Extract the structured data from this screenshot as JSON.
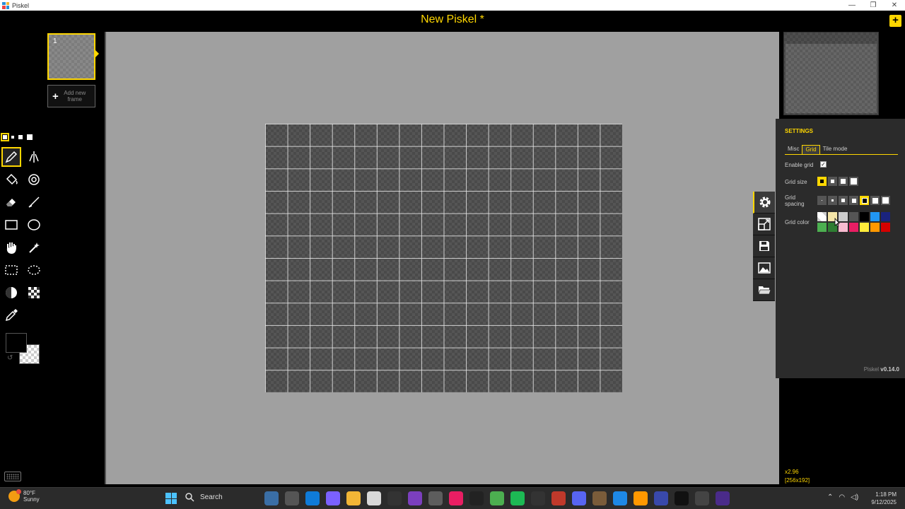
{
  "window": {
    "title": "Piskel",
    "min": "—",
    "max": "❐",
    "close": "✕"
  },
  "app": {
    "title": "New Piskel *",
    "new_button": "+"
  },
  "frames": {
    "current_frame_number": "1",
    "add_new_label": "Add new frame"
  },
  "canvas": {
    "columns": 16,
    "rows": 12
  },
  "settings": {
    "title": "SETTINGS",
    "tabs": [
      "Misc",
      "Grid",
      "Tile mode"
    ],
    "active_tab": "Grid",
    "enable_grid_label": "Enable grid",
    "enable_grid_checked": true,
    "grid_size_label": "Grid size",
    "grid_spacing_label": "Grid spacing",
    "grid_color_label": "Grid color",
    "grid_colors": [
      "#ffffff",
      "#f5e6a8",
      "#cccccc",
      "#555555",
      "#000000",
      "#2196f3",
      "#1a237e",
      "#4caf50",
      "#2e7d32",
      "#f8bbd0",
      "#e91e63",
      "#ffeb3b",
      "#ff9800",
      "#d50000"
    ],
    "version_prefix": "Piskel",
    "version": "v0.14.0"
  },
  "zoom": {
    "level": "x2.96",
    "size": "[256x192]"
  },
  "taskbar": {
    "temperature": "80°F",
    "condition": "Sunny",
    "search_label": "Search",
    "time": "1:18 PM",
    "date": "9/12/2025",
    "app_colors": [
      "#3a6ea5",
      "#555",
      "#0f7bd8",
      "#7b61ff",
      "#f2b636",
      "#d8d8d8",
      "#333",
      "#7b3fbe",
      "#5d5d5d",
      "#e91e63",
      "#222",
      "#4caf50",
      "#1db954",
      "#333",
      "#c0392b",
      "#5865f2",
      "#7a5c3a",
      "#1e88e5",
      "#ff9800",
      "#3949ab",
      "#111",
      "#444",
      "#4a2b8a"
    ]
  },
  "colors": {
    "accent": "#ffd700",
    "canvas_bg": "#a0a0a0",
    "panel_bg": "#2b2b2b"
  }
}
